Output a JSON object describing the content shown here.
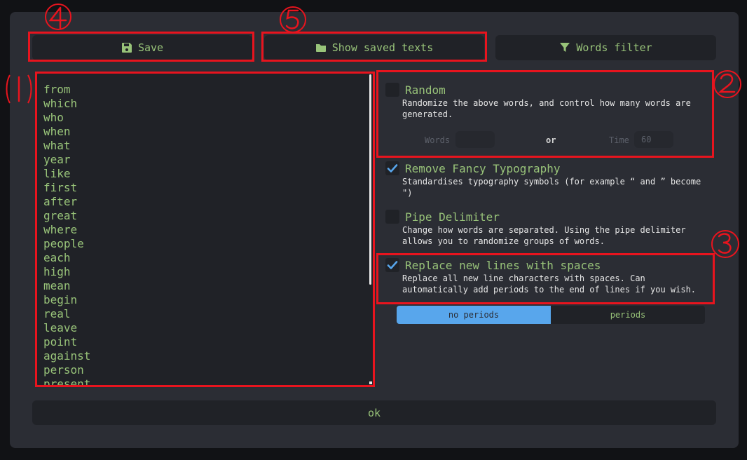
{
  "toolbar": {
    "save_label": "Save",
    "show_saved_label": "Show saved texts",
    "words_filter_label": "Words filter"
  },
  "editor": {
    "words": [
      "from",
      "which",
      "who",
      "when",
      "what",
      "year",
      "like",
      "first",
      "after",
      "great",
      "where",
      "people",
      "each",
      "high",
      "mean",
      "begin",
      "real",
      "leave",
      "point",
      "against",
      "person",
      "present"
    ]
  },
  "options": {
    "random": {
      "title": "Random",
      "desc": "Randomize the above words, and control how many words are generated.",
      "checked": false,
      "words_label": "Words",
      "words_value": "",
      "or_label": "or",
      "time_label": "Time",
      "time_value": "60"
    },
    "fancy": {
      "title": "Remove Fancy Typography",
      "desc": "Standardises typography symbols (for example “ and ” become \")",
      "checked": true
    },
    "pipe": {
      "title": "Pipe Delimiter",
      "desc": "Change how words are separated. Using the pipe delimiter allows you to randomize groups of words.",
      "checked": false
    },
    "newlines": {
      "title": "Replace new lines with spaces",
      "desc": "Replace all new line characters with spaces. Can automatically add periods to the end of lines if you wish.",
      "checked": true
    }
  },
  "periods_toggle": {
    "no_periods": "no periods",
    "periods": "periods",
    "selected": "no periods"
  },
  "ok_label": "ok",
  "annotations": [
    "1",
    "2",
    "3",
    "4",
    "5"
  ],
  "colors": {
    "accent": "#98c379",
    "toggle_active": "#58a6ec",
    "annotation": "#e8141e"
  }
}
